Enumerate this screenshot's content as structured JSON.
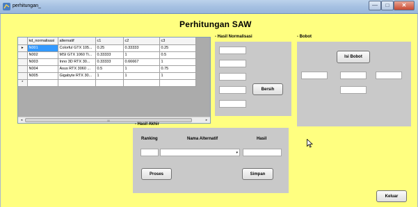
{
  "window": {
    "title": "perhitungan_",
    "minimize": "—",
    "maximize": "□",
    "close": "✕"
  },
  "heading": "Perhitungan SAW",
  "grid": {
    "columns": [
      "kd_normalisasi",
      "alternatif",
      "c1",
      "c2",
      "c3"
    ],
    "rows": [
      [
        "N001",
        "Colorful GTX 105...",
        "0.25",
        "0.33333",
        "0.25"
      ],
      [
        "N002",
        "MSI GTX 1060 Ti...",
        "0.33333",
        "1",
        "0.5"
      ],
      [
        "N003",
        "Inno 3D RTX 30...",
        "0.33333",
        "0.66667",
        "1"
      ],
      [
        "N004",
        "Asus RTX 3060 ...",
        "0.5",
        "1",
        "0.75"
      ],
      [
        "N005",
        "Gigabyte RTX 30...",
        "1",
        "1",
        "1"
      ]
    ],
    "current_row_marker": "▸",
    "new_row_marker": "*",
    "scroll_left": "◂",
    "scroll_right": "▸",
    "scroll_grip": "III"
  },
  "normalisasi": {
    "label": "- Hasil Normalisasi",
    "clear_button": "Bersih"
  },
  "bobot": {
    "label": "- Bobot",
    "fill_button": "Isi Bobot"
  },
  "akhir": {
    "label": "- Hasil Akhir",
    "col_rank": "Ranking",
    "col_name": "Nama Alternatif",
    "col_result": "Hasil",
    "combo_arrow": "▾",
    "process_button": "Proses",
    "save_button": "Simpan"
  },
  "exit_button": "Keluar"
}
